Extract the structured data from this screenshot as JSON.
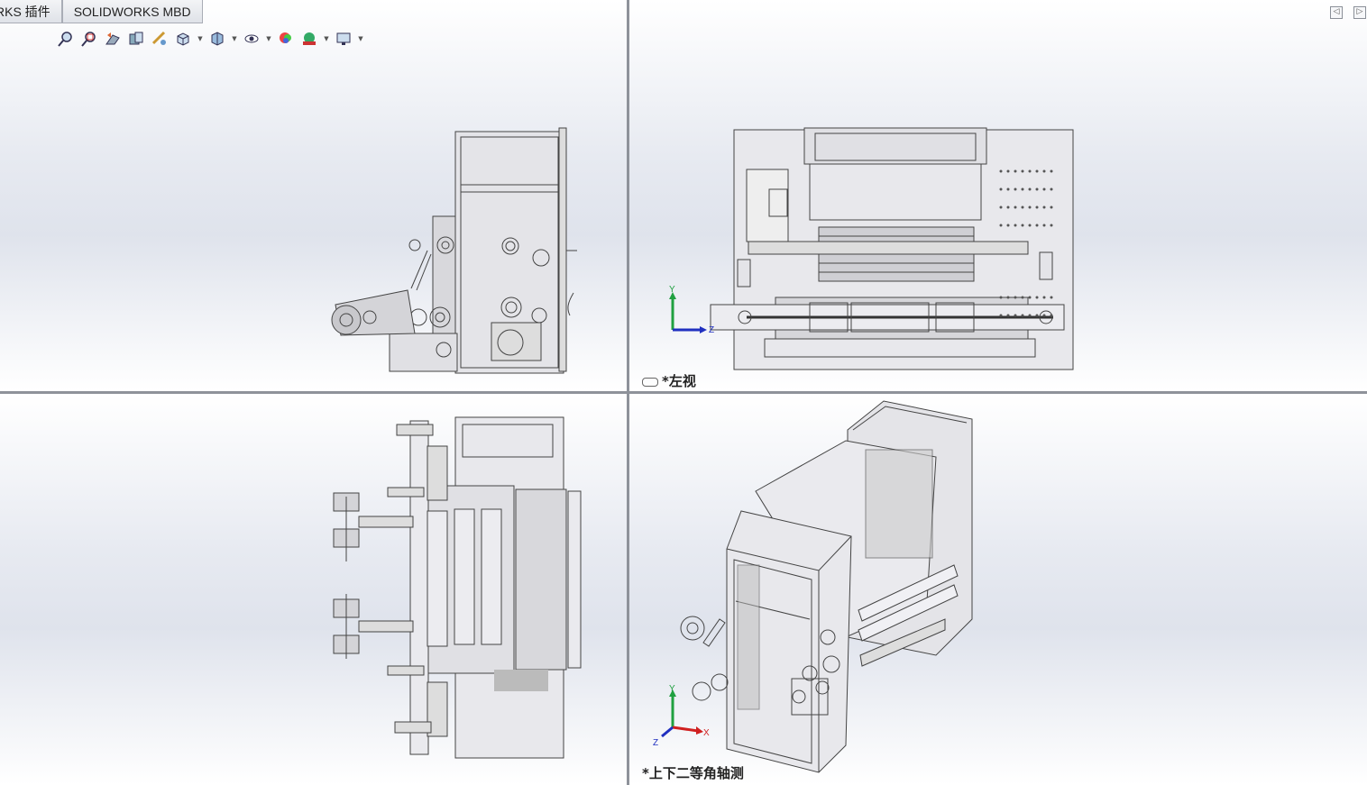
{
  "tabs": [
    {
      "label": "RKS 插件"
    },
    {
      "label": "SOLIDWORKS MBD"
    }
  ],
  "toolbar": {
    "icons": [
      "zoom-to-fit-icon",
      "zoom-area-icon",
      "previous-view-icon",
      "section-view-icon",
      "dynamic-annotation-icon",
      "view-orientation-icon",
      "display-style-icon",
      "hide-show-items-icon",
      "edit-appearance-icon",
      "apply-scene-icon",
      "view-settings-icon"
    ]
  },
  "views": {
    "top_left": {
      "label": ""
    },
    "top_right": {
      "label": "*左视"
    },
    "bottom_left": {
      "label": ""
    },
    "bottom_right": {
      "label": "*上下二等角轴测"
    }
  },
  "triad": {
    "x": "X",
    "y": "Y",
    "z": "Z"
  },
  "colors": {
    "background_top": "#ffffff",
    "background_mid": "#e0e4ec",
    "splitter": "#8e929a",
    "axis_x": "#d02020",
    "axis_y": "#20a040",
    "axis_z": "#2030c0"
  }
}
